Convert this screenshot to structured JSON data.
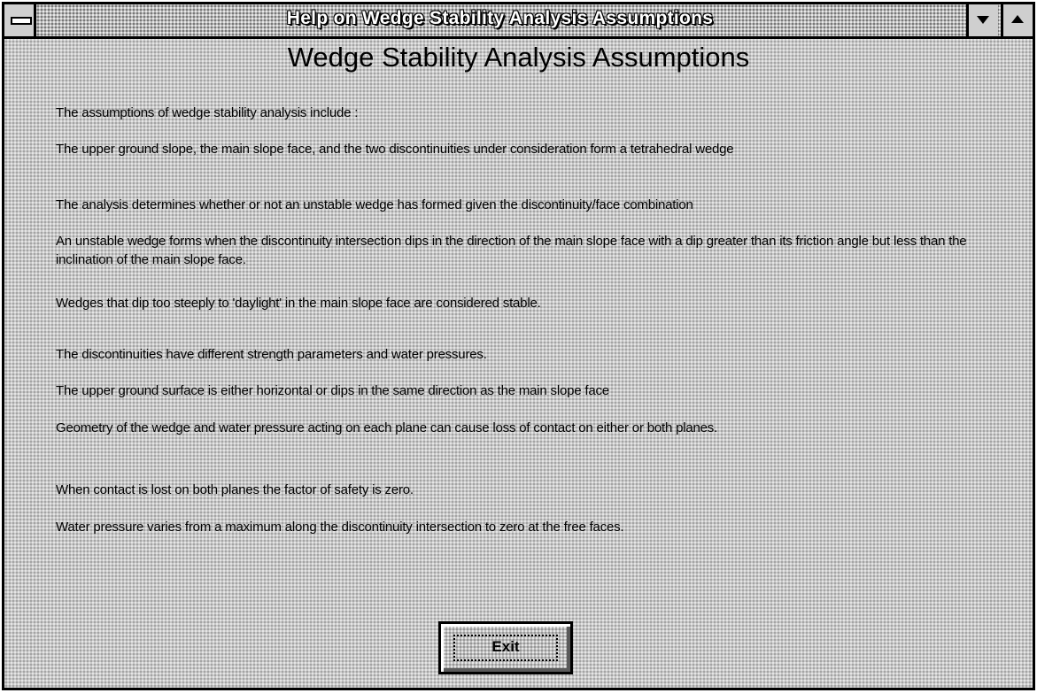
{
  "window": {
    "title": "Help on Wedge Stability Analysis Assumptions"
  },
  "content": {
    "heading": "Wedge Stability Analysis Assumptions",
    "paragraphs": [
      "The assumptions of wedge stability analysis include :",
      "The upper ground slope, the main slope face, and the two discontinuities under consideration form a tetrahedral wedge",
      "The analysis determines whether or not an unstable wedge has formed given the discontinuity/face combination",
      "An unstable wedge forms when the discontinuity intersection dips in the direction of the main slope face with a dip greater than its friction angle but less than the inclination of the main slope face.",
      "Wedges that dip too steeply to 'daylight' in the main slope face are considered stable.",
      "The discontinuities have different strength parameters and water pressures.",
      "The upper ground surface is either horizontal or dips in the same direction as the main slope face",
      "Geometry of the wedge and water pressure acting on each plane can cause loss of contact on either or both planes.",
      "When contact is lost on both planes the factor of safety is zero.",
      "Water pressure varies from a maximum along the discontinuity intersection to zero at the free faces."
    ]
  },
  "buttons": {
    "exit_label": "Exit"
  },
  "icons": {
    "system_menu": "system-menu-icon",
    "minimize": "minimize-arrow-icon",
    "maximize": "maximize-arrow-icon"
  }
}
